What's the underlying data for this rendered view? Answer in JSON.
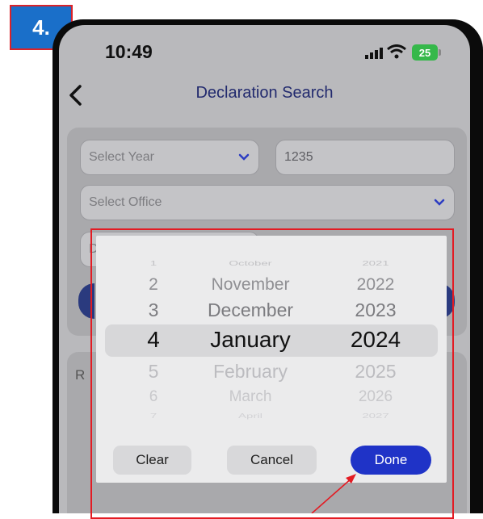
{
  "step_badge": "4.",
  "status_bar": {
    "time": "10:49",
    "battery": "25"
  },
  "nav": {
    "title": "Declaration Search"
  },
  "form": {
    "year_placeholder": "Select Year",
    "number_value": "1235",
    "office_placeholder": "Select Office",
    "partial_field": "D"
  },
  "results": {
    "label_partial": "R"
  },
  "picker": {
    "days": [
      "1",
      "2",
      "3",
      "4",
      "5",
      "6",
      "7"
    ],
    "months": [
      "October",
      "November",
      "December",
      "January",
      "February",
      "March",
      "April"
    ],
    "years": [
      "2021",
      "2022",
      "2023",
      "2024",
      "2025",
      "2026",
      "2027"
    ],
    "selected": {
      "day": "4",
      "month": "January",
      "year": "2024"
    },
    "buttons": {
      "clear": "Clear",
      "cancel": "Cancel",
      "done": "Done"
    }
  },
  "colors": {
    "badge": "#1a6fc9",
    "highlight_frame": "#e31b23",
    "done_button": "#1f33c7",
    "nav_title": "#222a6e",
    "battery": "#35b84a"
  },
  "icons": [
    "back-chevron-icon",
    "chevron-down-icon",
    "signal-icon",
    "wifi-icon",
    "battery-icon",
    "annotation-arrow"
  ]
}
